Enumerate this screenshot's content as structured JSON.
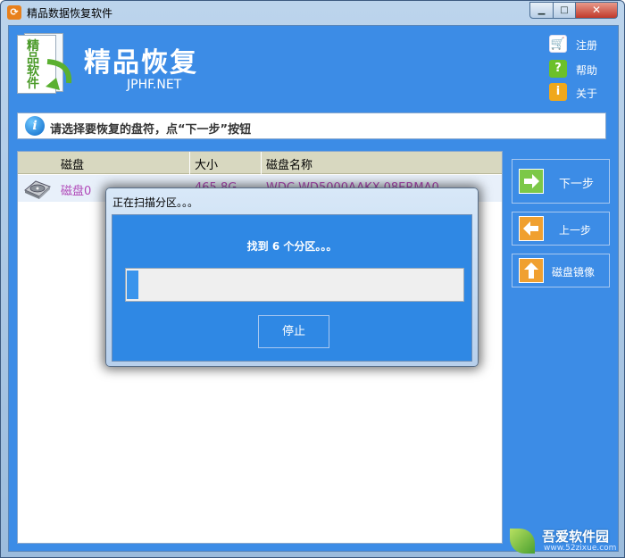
{
  "window": {
    "title": "精品数据恢复软件",
    "controls": {
      "minimize": "▁",
      "maximize": "□",
      "close": "✕"
    }
  },
  "header": {
    "logo_chars": [
      "精",
      "品",
      "软",
      "件"
    ],
    "app_name": "精品恢复",
    "site": "JPHF.NET",
    "links": {
      "register": {
        "label": "注册",
        "icon": "cart-icon"
      },
      "help": {
        "label": "帮助",
        "icon": "question-icon"
      },
      "about": {
        "label": "关于",
        "icon": "info-icon"
      }
    }
  },
  "instruction": {
    "icon": "info-icon",
    "text": "请选择要恢复的盘符，点“下一步”按钮"
  },
  "table": {
    "columns": [
      "磁盘",
      "大小",
      "磁盘名称"
    ],
    "rows": [
      {
        "disk": "磁盘0",
        "size": "465.8G",
        "name": "WDC WD5000AAKX-08ERMA0"
      }
    ]
  },
  "side_buttons": {
    "next": "下一步",
    "prev": "上一步",
    "image": "磁盘镜像"
  },
  "dialog": {
    "title": "正在扫描分区。。。",
    "status": "找到 6 个分区。。。",
    "progress": 0.035,
    "stop_label": "停止"
  },
  "watermark": {
    "text": "吾爱软件园",
    "sub": "www.52zixue.com"
  },
  "colors": {
    "client_bg": "#3c8ce6",
    "disk_text": "#b048b8",
    "header_row": "#d8d8c0"
  }
}
